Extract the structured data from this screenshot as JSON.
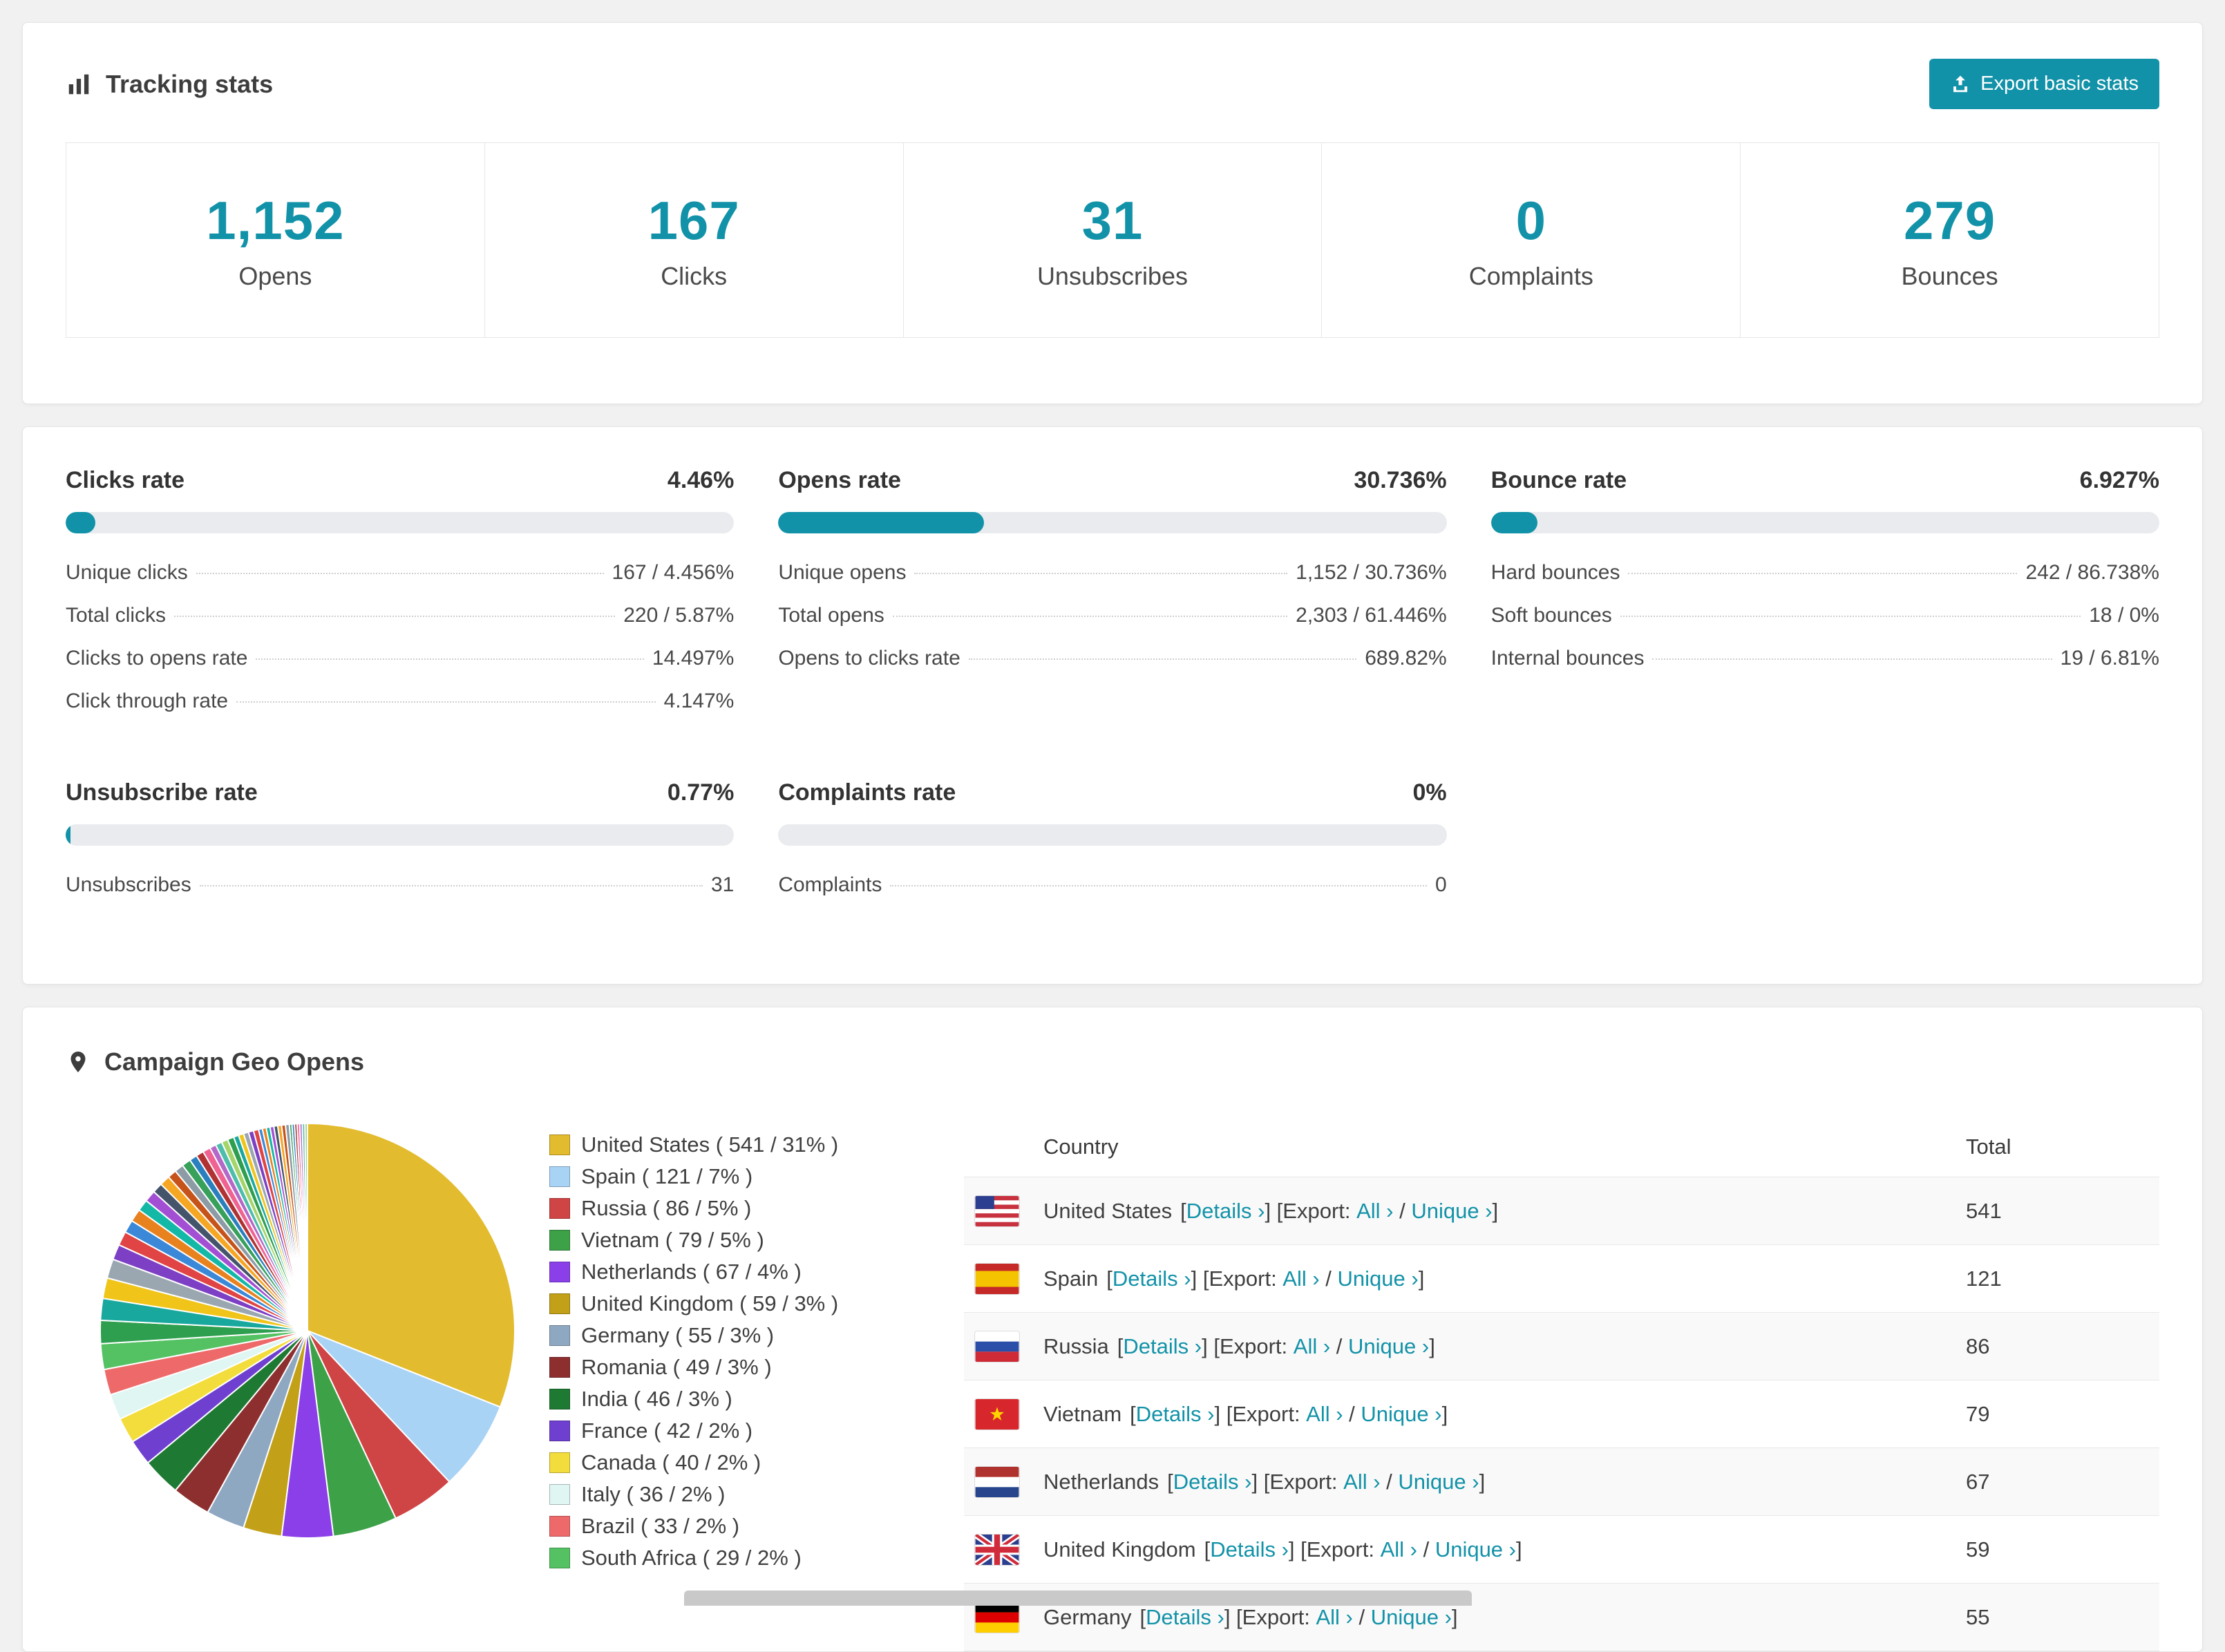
{
  "colors": {
    "accent": "#1292a8",
    "scrollbar": "#c9c9c9"
  },
  "tracking": {
    "title": "Tracking stats",
    "export_button": "Export basic stats",
    "stats": [
      {
        "value": "1,152",
        "label": "Opens"
      },
      {
        "value": "167",
        "label": "Clicks"
      },
      {
        "value": "31",
        "label": "Unsubscribes"
      },
      {
        "value": "0",
        "label": "Complaints"
      },
      {
        "value": "279",
        "label": "Bounces"
      }
    ]
  },
  "rates": [
    {
      "title": "Clicks rate",
      "display": "4.46%",
      "bar_percent": 4.46,
      "rows": [
        {
          "label": "Unique clicks",
          "value": "167 / 4.456%"
        },
        {
          "label": "Total clicks",
          "value": "220 / 5.87%"
        },
        {
          "label": "Clicks to opens rate",
          "value": "14.497%"
        },
        {
          "label": "Click through rate",
          "value": "4.147%"
        }
      ]
    },
    {
      "title": "Opens rate",
      "display": "30.736%",
      "bar_percent": 30.736,
      "rows": [
        {
          "label": "Unique opens",
          "value": "1,152 / 30.736%"
        },
        {
          "label": "Total opens",
          "value": "2,303 / 61.446%"
        },
        {
          "label": "Opens to clicks rate",
          "value": "689.82%"
        }
      ]
    },
    {
      "title": "Bounce rate",
      "display": "6.927%",
      "bar_percent": 6.927,
      "rows": [
        {
          "label": "Hard bounces",
          "value": "242 / 86.738%"
        },
        {
          "label": "Soft bounces",
          "value": "18 / 0%"
        },
        {
          "label": "Internal bounces",
          "value": "19 / 6.81%"
        }
      ]
    },
    {
      "title": "Unsubscribe rate",
      "display": "0.77%",
      "bar_percent": 0.77,
      "rows": [
        {
          "label": "Unsubscribes",
          "value": "31"
        }
      ]
    },
    {
      "title": "Complaints rate",
      "display": "0%",
      "bar_percent": 0,
      "rows": [
        {
          "label": "Complaints",
          "value": "0"
        }
      ]
    }
  ],
  "geo": {
    "title": "Campaign Geo Opens",
    "table": {
      "country_header": "Country",
      "total_header": "Total",
      "bracket_open": "[",
      "bracket_close": "]",
      "details_label": "Details ›",
      "export_label": "Export:",
      "all_label": "All ›",
      "slash": "/",
      "unique_label": "Unique ›",
      "rows": [
        {
          "country": "United States",
          "flag": "us",
          "total": "541"
        },
        {
          "country": "Spain",
          "flag": "es",
          "total": "121"
        },
        {
          "country": "Russia",
          "flag": "ru",
          "total": "86"
        },
        {
          "country": "Vietnam",
          "flag": "vn",
          "total": "79"
        },
        {
          "country": "Netherlands",
          "flag": "nl",
          "total": "67"
        },
        {
          "country": "United Kingdom",
          "flag": "gb",
          "total": "59"
        },
        {
          "country": "Germany",
          "flag": "de",
          "total": "55"
        }
      ]
    }
  },
  "chart_data": {
    "type": "pie",
    "title": "Campaign Geo Opens",
    "unit": "opens",
    "legend_position": "right",
    "slices": [
      {
        "label": "United States",
        "count": 541,
        "percent": 31,
        "color": "#e3bb2e"
      },
      {
        "label": "Spain",
        "count": 121,
        "percent": 7,
        "color": "#a9d3f5"
      },
      {
        "label": "Russia",
        "count": 86,
        "percent": 5,
        "color": "#cf4444"
      },
      {
        "label": "Vietnam",
        "count": 79,
        "percent": 5,
        "color": "#3da147"
      },
      {
        "label": "Netherlands",
        "count": 67,
        "percent": 4,
        "color": "#8a3fe8"
      },
      {
        "label": "United Kingdom",
        "count": 59,
        "percent": 3,
        "color": "#c2a018"
      },
      {
        "label": "Germany",
        "count": 55,
        "percent": 3,
        "color": "#8fa8c2"
      },
      {
        "label": "Romania",
        "count": 49,
        "percent": 3,
        "color": "#8e2f2f"
      },
      {
        "label": "India",
        "count": 46,
        "percent": 3,
        "color": "#1e7a33"
      },
      {
        "label": "France",
        "count": 42,
        "percent": 2,
        "color": "#6f40d0"
      },
      {
        "label": "Canada",
        "count": 40,
        "percent": 2,
        "color": "#f3dd3c"
      },
      {
        "label": "Italy",
        "count": 36,
        "percent": 2,
        "color": "#dff6f3"
      },
      {
        "label": "Brazil",
        "count": 33,
        "percent": 2,
        "color": "#ee6a6a"
      },
      {
        "label": "South Africa",
        "count": 29,
        "percent": 2,
        "color": "#54c263"
      }
    ],
    "others": {
      "note": "remaining ~26% of opens shown as many thin unlabeled slices",
      "values": [
        1.8,
        1.7,
        1.6,
        1.5,
        1.2,
        1.1,
        1.0,
        1.0,
        0.9,
        0.9,
        0.8,
        0.8,
        0.7,
        0.7,
        0.7,
        0.6,
        0.6,
        0.6,
        0.5,
        0.5,
        0.5,
        0.5,
        0.4,
        0.4,
        0.4,
        0.4,
        0.4,
        0.3,
        0.3,
        0.3,
        0.3,
        0.3,
        0.3,
        0.3,
        0.3,
        0.2,
        0.2,
        0.2,
        0.2,
        0.2,
        0.2,
        0.2
      ],
      "colors": [
        "#2e9e4f",
        "#18a89e",
        "#f0c419",
        "#9aa7b0",
        "#7d3fc4",
        "#e04444",
        "#3b88d8",
        "#e8821e",
        "#14b8a6",
        "#a34fd4",
        "#44546a",
        "#f5a623",
        "#c6541a",
        "#8c9ba5",
        "#37a05b",
        "#2a7fbf",
        "#b03232",
        "#ef6292",
        "#b468c8",
        "#4dbdac",
        "#a5d46a"
      ]
    }
  }
}
